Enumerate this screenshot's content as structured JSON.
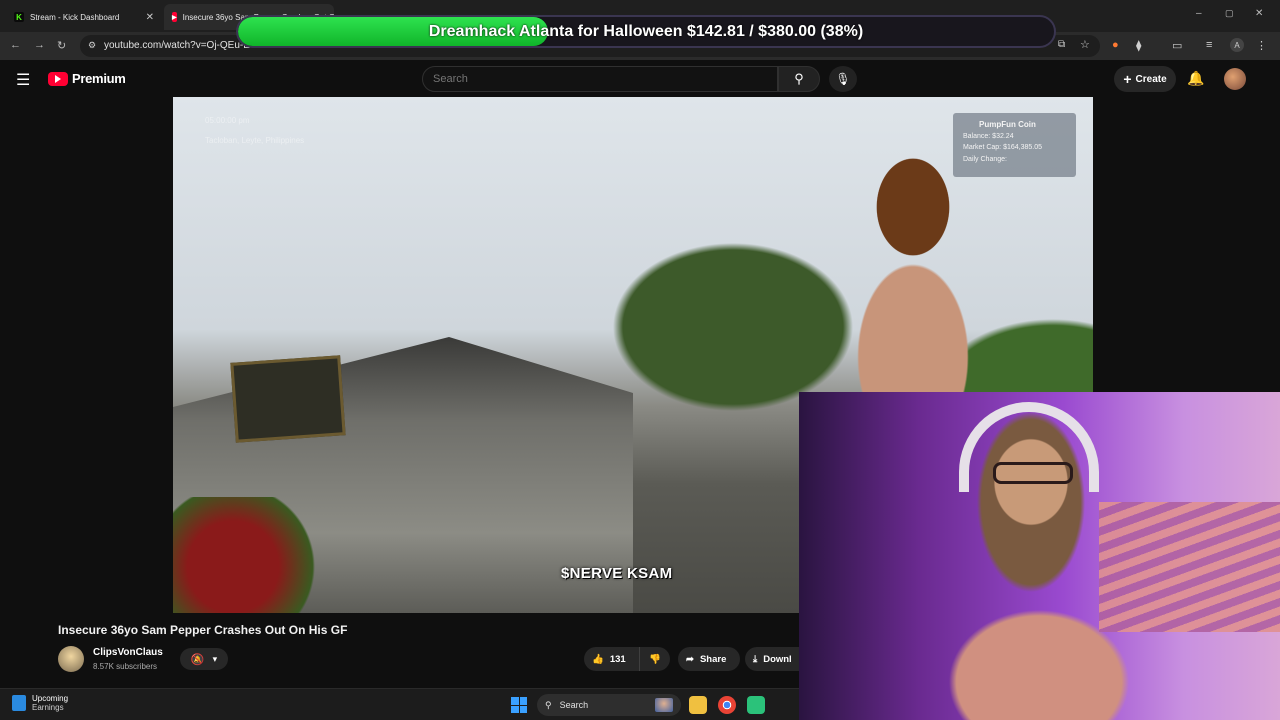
{
  "browser": {
    "tabs": [
      {
        "title": "Stream - Kick Dashboard",
        "favicon": "kick-icon",
        "color": "#53fc18"
      },
      {
        "title": "Insecure 36yo Sam Pepper Crashes Out On His GF",
        "favicon": "youtube-icon",
        "color": "#ff0033"
      }
    ],
    "url": "youtube.com/watch?v=Oj-QEu-E",
    "window_buttons": {
      "minimize": "–",
      "maximize": "▢",
      "close": "✕"
    }
  },
  "donation_goal": {
    "text": "Dreamhack Atlanta for Halloween $142.81 / $380.00 (38%)",
    "progress_percent": 38,
    "color": "#1fcf3b"
  },
  "youtube": {
    "logo_label": "Premium",
    "search_placeholder": "Search",
    "create_label": "Create"
  },
  "video": {
    "location_line1": "05:00:00 pm",
    "location_line2": "Tacloban, Leyte, Philippines",
    "coin_widget": {
      "title": "PumpFun Coin",
      "balance": "Balance: $32.24",
      "market_cap": "Market Cap: $164,385.05",
      "daily_change": "Daily Change:"
    },
    "ticker_text": "$NERVE KSAM",
    "title": "Insecure 36yo Sam Pepper Crashes Out On His GF",
    "channel": {
      "name": "ClipsVonClaus",
      "subscribers": "8.57K subscribers"
    },
    "likes": "131",
    "share_label": "Share",
    "download_label": "Downl"
  },
  "taskbar": {
    "weather_title": "Upcoming",
    "weather_sub": "Earnings",
    "search_label": "Search"
  }
}
